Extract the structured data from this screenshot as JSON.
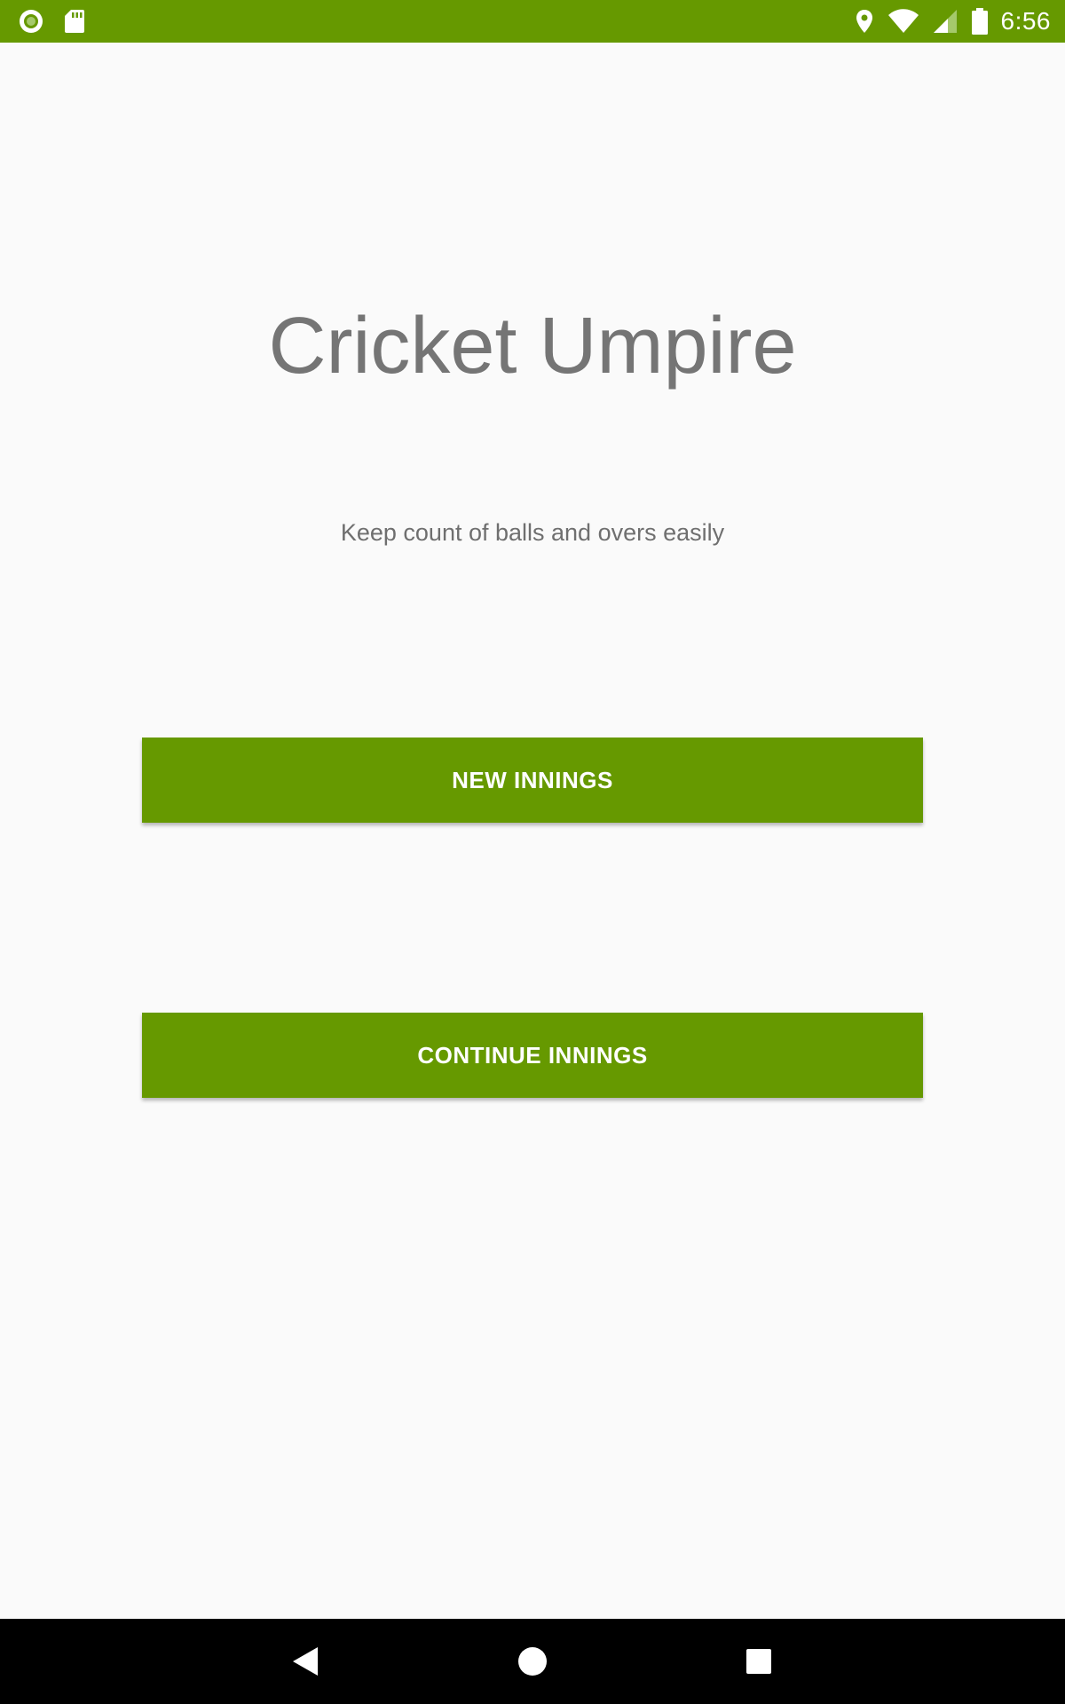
{
  "status_bar": {
    "time": "6:56",
    "background_color": "#669900",
    "left_icons": [
      "circle-record-icon",
      "sd-card-icon"
    ],
    "right_icons": [
      "location-pin-icon",
      "wifi-icon",
      "cell-signal-icon",
      "battery-icon"
    ]
  },
  "main": {
    "title": "Cricket Umpire",
    "subtitle": "Keep count of balls and overs easily",
    "accent_color": "#669900",
    "buttons": [
      {
        "label": "NEW INNINGS"
      },
      {
        "label": "CONTINUE INNINGS"
      }
    ]
  },
  "nav_bar": {
    "icons": [
      "back-triangle-icon",
      "home-circle-icon",
      "recents-square-icon"
    ]
  }
}
